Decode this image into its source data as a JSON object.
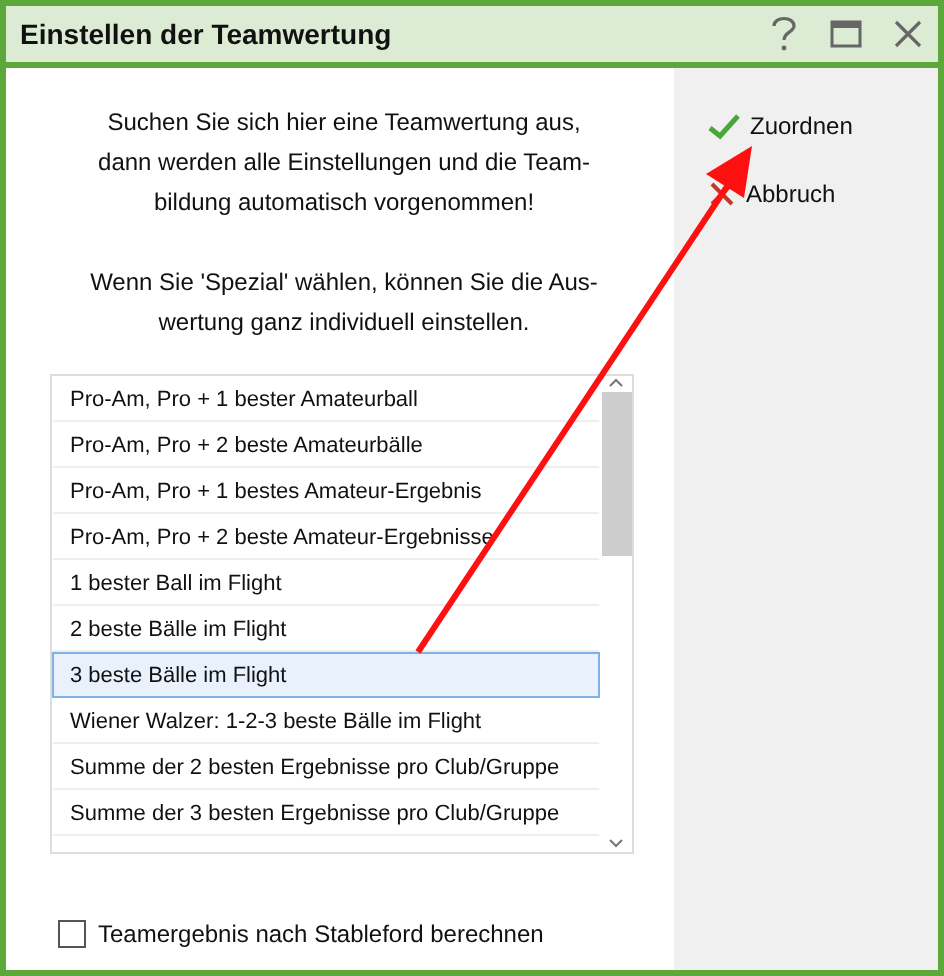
{
  "window": {
    "title": "Einstellen der Teamwertung"
  },
  "intro": [
    "Suchen Sie sich hier eine Teamwertung aus,\ndann werden alle Einstellungen und die Team-\nbildung automatisch vorgenommen!",
    "Wenn Sie 'Spezial' wählen, können Sie die Aus-\nwertung ganz individuell einstellen."
  ],
  "list": [
    {
      "label": "Pro-Am, Pro + 1 bester Amateurball",
      "selected": false
    },
    {
      "label": "Pro-Am, Pro + 2 beste Amateurbälle",
      "selected": false
    },
    {
      "label": "Pro-Am, Pro + 1 bestes Amateur-Ergebnis",
      "selected": false
    },
    {
      "label": "Pro-Am, Pro + 2 beste Amateur-Ergebnisse",
      "selected": false
    },
    {
      "label": "1 bester Ball im Flight",
      "selected": false
    },
    {
      "label": "2 beste Bälle im Flight",
      "selected": false
    },
    {
      "label": "3 beste Bälle im Flight",
      "selected": true
    },
    {
      "label": "Wiener Walzer: 1-2-3 beste Bälle im Flight",
      "selected": false
    },
    {
      "label": "Summe der 2 besten Ergebnisse pro Club/Gruppe",
      "selected": false
    },
    {
      "label": "Summe der 3 besten Ergebnisse pro Club/Gruppe",
      "selected": false
    }
  ],
  "checkbox": {
    "label": "Teamergebnis nach Stableford berechnen",
    "checked": false
  },
  "actions": [
    {
      "kind": "confirm",
      "label": "Zuordnen"
    },
    {
      "kind": "cancel",
      "label": "Abbruch"
    }
  ]
}
